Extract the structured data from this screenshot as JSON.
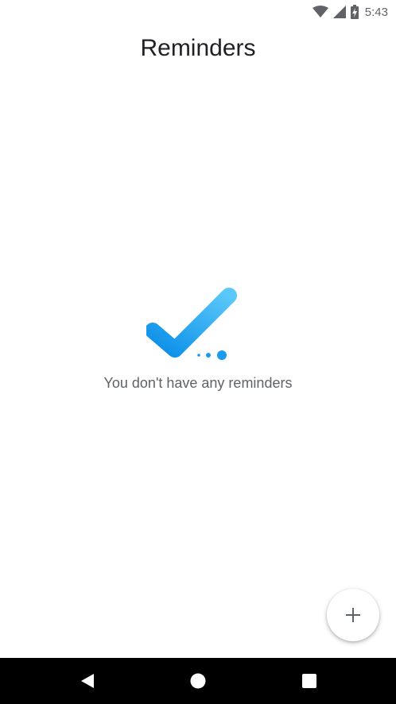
{
  "status_bar": {
    "time": "5:43",
    "icons": [
      "wifi-icon",
      "cellular-signal-icon",
      "battery-charging-icon"
    ]
  },
  "header": {
    "title": "Reminders"
  },
  "empty_state": {
    "illustration": "checkmark-icon",
    "message": "You don't have any reminders"
  },
  "fab": {
    "icon": "plus-icon"
  },
  "nav_bar": {
    "buttons": [
      "back",
      "home",
      "recents"
    ]
  },
  "colors": {
    "accent": "#1a9bf0",
    "accent_light": "#4fc3f7",
    "title": "#202124",
    "secondary_text": "#5f6368"
  }
}
